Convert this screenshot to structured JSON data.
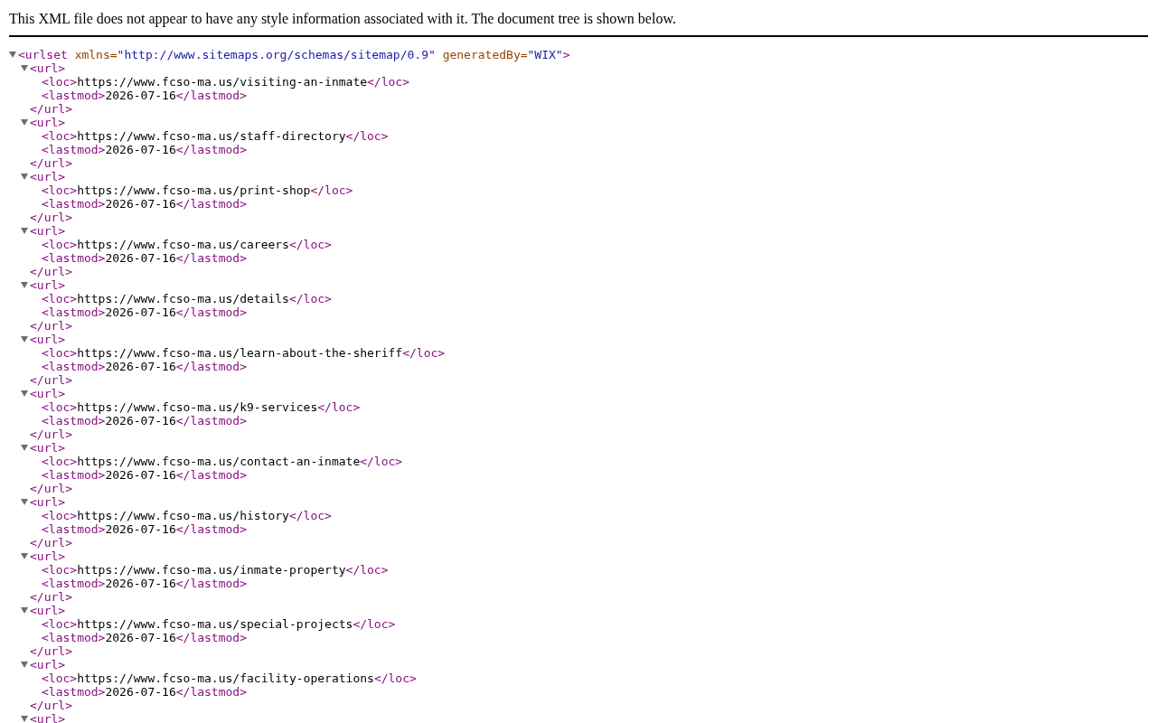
{
  "notice": "This XML file does not appear to have any style information associated with it. The document tree is shown below.",
  "tree": {
    "open": "<urlset",
    "attributes": [
      {
        "name": "xmlns=",
        "value": "\"http://www.sitemaps.org/schemas/sitemap/0.9\""
      },
      {
        "name": "generatedBy=",
        "value": "\"WIX\""
      }
    ],
    "open_end": ">",
    "expanded": true,
    "children": [
      {
        "open": "<url>",
        "expanded": true,
        "children": [
          {
            "open": "<loc>",
            "text": "https://www.fcso-ma.us/visiting-an-inmate",
            "close": "</loc>"
          },
          {
            "open": "<lastmod>",
            "text": "2026-07-16",
            "close": "</lastmod>"
          }
        ],
        "close": "</url>"
      },
      {
        "open": "<url>",
        "expanded": true,
        "children": [
          {
            "open": "<loc>",
            "text": "https://www.fcso-ma.us/staff-directory",
            "close": "</loc>"
          },
          {
            "open": "<lastmod>",
            "text": "2026-07-16",
            "close": "</lastmod>"
          }
        ],
        "close": "</url>"
      },
      {
        "open": "<url>",
        "expanded": true,
        "children": [
          {
            "open": "<loc>",
            "text": "https://www.fcso-ma.us/print-shop",
            "close": "</loc>"
          },
          {
            "open": "<lastmod>",
            "text": "2026-07-16",
            "close": "</lastmod>"
          }
        ],
        "close": "</url>"
      },
      {
        "open": "<url>",
        "expanded": true,
        "children": [
          {
            "open": "<loc>",
            "text": "https://www.fcso-ma.us/careers",
            "close": "</loc>"
          },
          {
            "open": "<lastmod>",
            "text": "2026-07-16",
            "close": "</lastmod>"
          }
        ],
        "close": "</url>"
      },
      {
        "open": "<url>",
        "expanded": true,
        "children": [
          {
            "open": "<loc>",
            "text": "https://www.fcso-ma.us/details",
            "close": "</loc>"
          },
          {
            "open": "<lastmod>",
            "text": "2026-07-16",
            "close": "</lastmod>"
          }
        ],
        "close": "</url>"
      },
      {
        "open": "<url>",
        "expanded": true,
        "children": [
          {
            "open": "<loc>",
            "text": "https://www.fcso-ma.us/learn-about-the-sheriff",
            "close": "</loc>"
          },
          {
            "open": "<lastmod>",
            "text": "2026-07-16",
            "close": "</lastmod>"
          }
        ],
        "close": "</url>"
      },
      {
        "open": "<url>",
        "expanded": true,
        "children": [
          {
            "open": "<loc>",
            "text": "https://www.fcso-ma.us/k9-services",
            "close": "</loc>"
          },
          {
            "open": "<lastmod>",
            "text": "2026-07-16",
            "close": "</lastmod>"
          }
        ],
        "close": "</url>"
      },
      {
        "open": "<url>",
        "expanded": true,
        "children": [
          {
            "open": "<loc>",
            "text": "https://www.fcso-ma.us/contact-an-inmate",
            "close": "</loc>"
          },
          {
            "open": "<lastmod>",
            "text": "2026-07-16",
            "close": "</lastmod>"
          }
        ],
        "close": "</url>"
      },
      {
        "open": "<url>",
        "expanded": true,
        "children": [
          {
            "open": "<loc>",
            "text": "https://www.fcso-ma.us/history",
            "close": "</loc>"
          },
          {
            "open": "<lastmod>",
            "text": "2026-07-16",
            "close": "</lastmod>"
          }
        ],
        "close": "</url>"
      },
      {
        "open": "<url>",
        "expanded": true,
        "children": [
          {
            "open": "<loc>",
            "text": "https://www.fcso-ma.us/inmate-property",
            "close": "</loc>"
          },
          {
            "open": "<lastmod>",
            "text": "2026-07-16",
            "close": "</lastmod>"
          }
        ],
        "close": "</url>"
      },
      {
        "open": "<url>",
        "expanded": true,
        "children": [
          {
            "open": "<loc>",
            "text": "https://www.fcso-ma.us/special-projects",
            "close": "</loc>"
          },
          {
            "open": "<lastmod>",
            "text": "2026-07-16",
            "close": "</lastmod>"
          }
        ],
        "close": "</url>"
      },
      {
        "open": "<url>",
        "expanded": true,
        "children": [
          {
            "open": "<loc>",
            "text": "https://www.fcso-ma.us/facility-operations",
            "close": "</loc>"
          },
          {
            "open": "<lastmod>",
            "text": "2026-07-16",
            "close": "</lastmod>"
          }
        ],
        "close": "</url>"
      },
      {
        "open": "<url>",
        "expanded": true
      }
    ]
  }
}
